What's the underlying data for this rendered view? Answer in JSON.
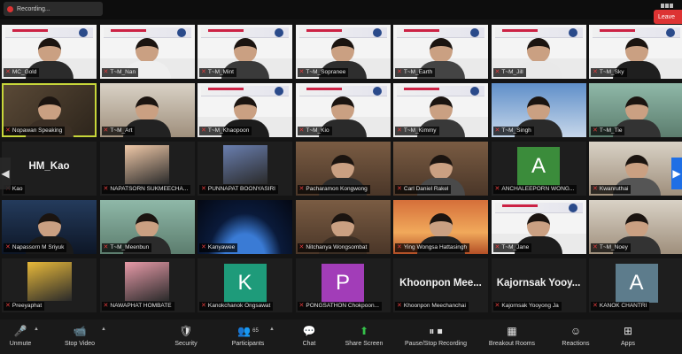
{
  "meeting": {
    "title": "Recording..."
  },
  "tiles": [
    {
      "name": "MC_Gold",
      "bg": "banner",
      "kind": "person",
      "shirt": "#2b2b2b"
    },
    {
      "name": "T~M_Nan",
      "bg": "banner",
      "kind": "person",
      "shirt": "#efefef"
    },
    {
      "name": "T~M_Mint",
      "bg": "banner",
      "kind": "person",
      "shirt": "#3a3a3a"
    },
    {
      "name": "T~M_Sopranee",
      "bg": "banner",
      "kind": "person",
      "shirt": "#2e2e2e"
    },
    {
      "name": "T~M_Earth",
      "bg": "banner",
      "kind": "person",
      "shirt": "#444"
    },
    {
      "name": "T~M_Jill",
      "bg": "banner",
      "kind": "person",
      "shirt": "#e9e9e9"
    },
    {
      "name": "T~M_Sky",
      "bg": "banner",
      "kind": "person",
      "shirt": "#1f1f1f"
    },
    {
      "name": "Nopawan Speaking",
      "bg": "warm",
      "kind": "person",
      "shirt": "#3b2f25",
      "speaking": true
    },
    {
      "name": "T~M_Art",
      "bg": "room",
      "kind": "person",
      "shirt": "#222"
    },
    {
      "name": "T~M_Khaopoon",
      "bg": "banner",
      "kind": "person",
      "shirt": "#1c1c1c"
    },
    {
      "name": "T~M_Kio",
      "bg": "banner",
      "kind": "person",
      "shirt": "#2a2a2a"
    },
    {
      "name": "T~M_Kimmy",
      "bg": "banner",
      "kind": "person",
      "shirt": "#393939"
    },
    {
      "name": "T~M_Singh",
      "bg": "sky",
      "kind": "person",
      "shirt": "#2a2a2a"
    },
    {
      "name": "T~M_Tie",
      "bg": "greenroom",
      "kind": "person",
      "shirt": "#333"
    },
    {
      "name": "Kao",
      "bg": "dark",
      "kind": "nameonly",
      "label": "HM_Kao"
    },
    {
      "name": "NAPATSORN SUKMEECHA...",
      "bg": "dark",
      "kind": "pic",
      "color": "#f0c9a8"
    },
    {
      "name": "PUNNAPAT BOONYASIRI",
      "bg": "dark",
      "kind": "pic",
      "color": "#6a7fb0"
    },
    {
      "name": "Pacharamon Kongwong",
      "bg": "cozy",
      "kind": "person",
      "shirt": "#2b2b2b"
    },
    {
      "name": "Carl Daniel Rakel",
      "bg": "cozy",
      "kind": "person",
      "shirt": "#4a4a4a"
    },
    {
      "name": "ANCHALEEPORN WONG...",
      "bg": "dark",
      "kind": "letter",
      "letter": "A",
      "color": "#3b8c3b"
    },
    {
      "name": "Kwanruthai",
      "bg": "room",
      "kind": "person",
      "shirt": "#555"
    },
    {
      "name": "Napassorn M Sriyuk",
      "bg": "night",
      "kind": "person",
      "shirt": "#1a1a1a"
    },
    {
      "name": "T~M_Meenbun",
      "bg": "greenroom",
      "kind": "person",
      "shirt": "#2b2b2b"
    },
    {
      "name": "Kanyawee",
      "bg": "space",
      "kind": "empty"
    },
    {
      "name": "Nitchanya Wongsombat",
      "bg": "cozy",
      "kind": "person",
      "shirt": "#3a2d23"
    },
    {
      "name": "Ying Wongsa Hattasingh",
      "bg": "sunset",
      "kind": "person",
      "shirt": "#222"
    },
    {
      "name": "T~M_Jane",
      "bg": "banner",
      "kind": "person",
      "shirt": "#1c1c1c"
    },
    {
      "name": "T~M_Noey",
      "bg": "room",
      "kind": "person",
      "shirt": "#333"
    },
    {
      "name": "Preeyaphat",
      "bg": "dark",
      "kind": "pic",
      "color": "#e8b93a"
    },
    {
      "name": "NAWAPHAT HOMBATE",
      "bg": "dark",
      "kind": "pic",
      "color": "#e79aa8"
    },
    {
      "name": "Kanokchanok Ongsawat",
      "bg": "dark",
      "kind": "letter",
      "letter": "K",
      "color": "#1e9b7a"
    },
    {
      "name": "PONGSATHON Chokpoon...",
      "bg": "dark",
      "kind": "letter",
      "letter": "P",
      "color": "#a23db8"
    },
    {
      "name": "Khoonpon Meechanchai",
      "bg": "dark",
      "kind": "nameonly",
      "label": "Khoonpon Mee..."
    },
    {
      "name": "Kajornsak Yooyong Ja",
      "bg": "dark",
      "kind": "nameonly",
      "label": "Kajornsak Yooy..."
    },
    {
      "name": "KANOK CHANTRI",
      "bg": "dark",
      "kind": "letter",
      "letter": "A",
      "color": "#5d7c8c"
    }
  ],
  "toolbar": {
    "items": [
      {
        "key": "unmute",
        "label": "Unmute",
        "icon": "mic-off-icon",
        "glyph": "🎤"
      },
      {
        "key": "stop_video",
        "label": "Stop Video",
        "icon": "video-camera-icon",
        "glyph": "📹"
      },
      {
        "key": "security",
        "label": "Security",
        "icon": "shield-icon",
        "glyph": "🛡"
      },
      {
        "key": "participants",
        "label": "Participants",
        "icon": "participants-icon",
        "glyph": "👥",
        "count": "65"
      },
      {
        "key": "chat",
        "label": "Chat",
        "icon": "chat-icon",
        "glyph": "💬"
      },
      {
        "key": "share_screen",
        "label": "Share Screen",
        "icon": "share-screen-icon",
        "glyph": "⬆"
      },
      {
        "key": "recording",
        "label": "Pause/Stop Recording",
        "icon": "recording-icon",
        "glyph": "⏸ ⏹"
      },
      {
        "key": "breakout",
        "label": "Breakout Rooms",
        "icon": "breakout-rooms-icon",
        "glyph": "▦"
      },
      {
        "key": "reactions",
        "label": "Reactions",
        "icon": "reactions-icon",
        "glyph": "☺"
      },
      {
        "key": "apps",
        "label": "Apps",
        "icon": "apps-icon",
        "glyph": "⊞"
      }
    ],
    "leave_label": "Leave"
  },
  "colors": {
    "speaking_outline": "#c7d63a",
    "mic_muted": "#e23b3b",
    "share_green": "#35c24a",
    "leave_red": "#dd3333"
  }
}
